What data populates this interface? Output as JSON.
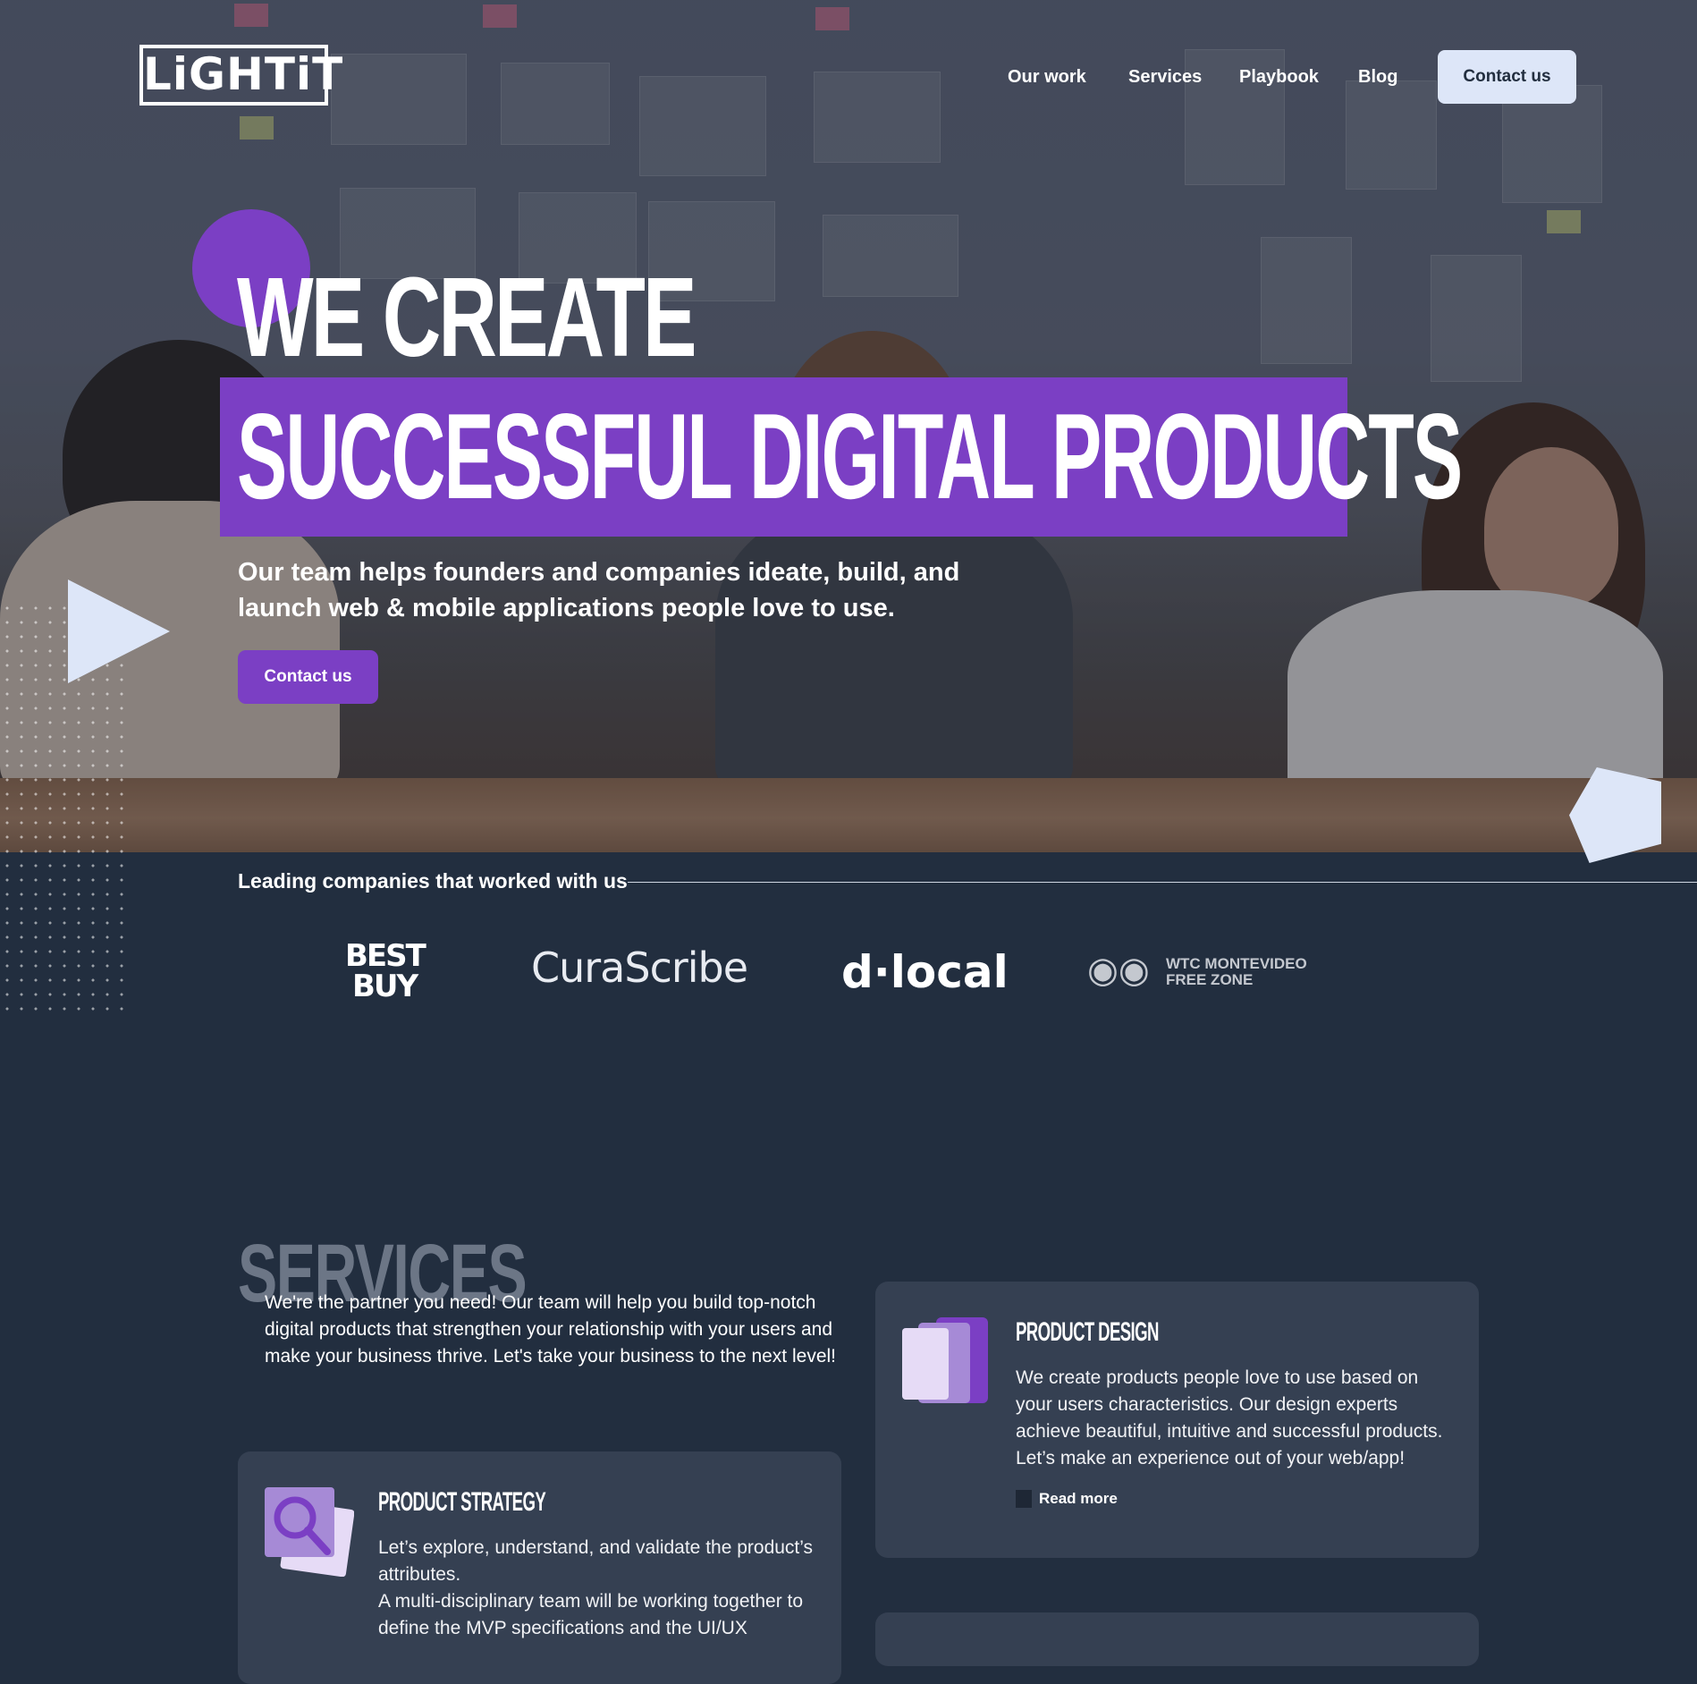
{
  "header": {
    "logo_text": "LiGHTiT",
    "nav": [
      "Our work",
      "Services",
      "Playbook",
      "Blog"
    ],
    "contact_label": "Contact us"
  },
  "hero": {
    "headline_line1": "WE CREATE",
    "headline_line2": "SUCCESSFUL DIGITAL PRODUCTS",
    "subtitle": "Our team helps founders and companies ideate, build, and launch web & mobile applications people love to use.",
    "cta_label": "Contact us"
  },
  "clients": {
    "title": "Leading companies that worked with us",
    "logos": {
      "bestbuy_line1": "BEST",
      "bestbuy_line2": "BUY",
      "curascribe": "CuraScribe",
      "dlocal": "d·local",
      "wtc_line1": "WTC MONTEVIDEO",
      "wtc_line2": "FREE ZONE"
    }
  },
  "services": {
    "section_title": "SERVICES",
    "intro": "We're the partner you need! Our team will help you build top-notch digital products that strengthen your relationship with your users and make your business thrive. Let's take your business to the next level!",
    "cards": [
      {
        "title": "PRODUCT DESIGN",
        "text": "We create products people love to use based on your users characteristics. Our design experts achieve beautiful, intuitive and successful products. Let’s make an experience out of your web/app!",
        "link": "Read more"
      },
      {
        "title": "PRODUCT STRATEGY",
        "text_line1": "Let’s explore, understand, and validate the product’s attributes.",
        "text_line2": "A multi-disciplinary team will be working together to define the MVP specifications and the UI/UX"
      }
    ]
  },
  "colors": {
    "purple": "#7b3fc4",
    "navy": "#222e3f",
    "card": "#354052",
    "pale_blue": "#dde6f8"
  }
}
